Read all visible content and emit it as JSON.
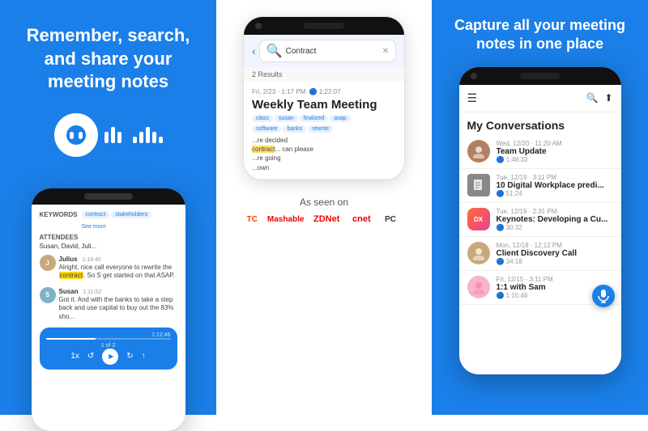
{
  "panel_left": {
    "tagline": "Remember, search, and share your meeting notes",
    "logo_alt": "Otter.ai logo"
  },
  "panel_mid": {
    "search_query": "Contract",
    "results_count": "2 Results",
    "meeting_title": "Weekly Team Meeting",
    "meeting_meta": "Fri, 2/23 · 1:17 PM  🔵 1:22:07",
    "keywords_label": "KEYWORDS",
    "keywords": [
      "contract",
      "rewrite"
    ],
    "attendees_label": "ATTENDEES",
    "attendees": "class, susan, finalized, asap, banks, rewrite, software",
    "transcript_snippet": "re decided can please re going own",
    "as_seen_label": "As seen on",
    "media": [
      {
        "name": "TechCrunch",
        "abbr": "TC"
      },
      {
        "name": "Mashable",
        "abbr": "Mashable"
      },
      {
        "name": "ZDNet",
        "abbr": "ZDNet"
      },
      {
        "name": "CNET",
        "abbr": "cnet"
      },
      {
        "name": "PC Magazine",
        "abbr": "PC"
      }
    ]
  },
  "panel_right": {
    "tagline": "Capture all your meeting notes in one place",
    "header_title": "My Conversations",
    "conversations": [
      {
        "date": "Wed, 12/20 · 11:20 AM",
        "name": "Team Update",
        "duration": "🔵 1:48:33",
        "avatar_type": "photo",
        "avatar_initials": "👤"
      },
      {
        "date": "Tue, 12/19 · 3:11 PM",
        "name": "10 Digital Workplace predi...",
        "duration": "🔵 51:24",
        "avatar_type": "doc",
        "avatar_initials": "📄"
      },
      {
        "date": "Tue, 12/19 · 2:31 PM",
        "name": "Keynotes: Developing a Cu...",
        "duration": "🔵 30:32",
        "avatar_type": "orange",
        "avatar_initials": "DX"
      },
      {
        "date": "Mon, 12/18 · 12:12 PM",
        "name": "Client Discovery Call",
        "duration": "🔵 34:18",
        "avatar_type": "green",
        "avatar_initials": "👤"
      },
      {
        "date": "Fri, 12/15 · 3:11 PM",
        "name": "1:1 with Sam",
        "duration": "🔵 1:15:46",
        "avatar_type": "pink",
        "avatar_initials": "👤"
      }
    ]
  },
  "chat_bubbles": [
    {
      "name": "Julius",
      "time": "1:14:40",
      "text": "Alright, nice call everyone to rewrite the contract. So S get started on that ASAP.",
      "has_highlight": true,
      "highlight_word": "contract"
    },
    {
      "name": "Susan",
      "time": "1:11:52",
      "text": "Got it. And with the banks to take a step back and use capital to buy out the 83%...",
      "has_highlight": false
    }
  ],
  "player": {
    "time_elapsed": "1:12:46",
    "speed": "1x",
    "pagination": "1 of 2"
  }
}
